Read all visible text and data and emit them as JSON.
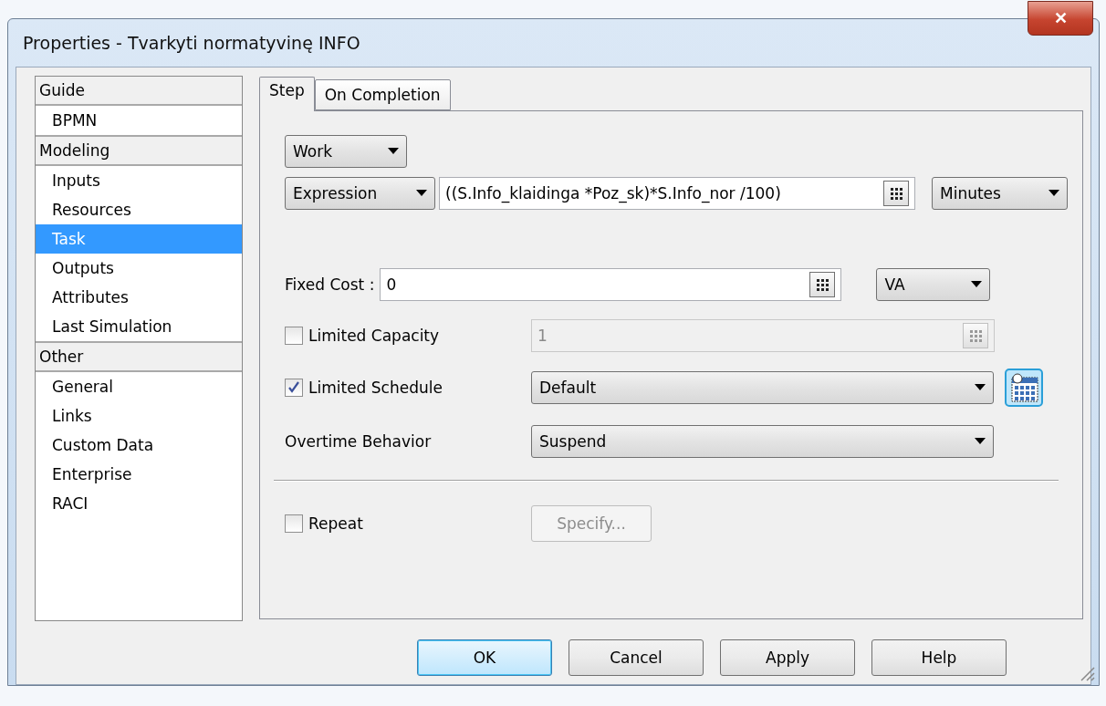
{
  "window": {
    "title": "Properties - Tvarkyti normatyvinę INFO",
    "close": "✕"
  },
  "sidebar": {
    "groups": [
      {
        "label": "Guide",
        "items": [
          {
            "label": "BPMN",
            "selected": false
          }
        ]
      },
      {
        "label": "Modeling",
        "items": [
          {
            "label": "Inputs",
            "selected": false
          },
          {
            "label": "Resources",
            "selected": false
          },
          {
            "label": "Task",
            "selected": true
          },
          {
            "label": "Outputs",
            "selected": false
          },
          {
            "label": "Attributes",
            "selected": false
          },
          {
            "label": "Last Simulation",
            "selected": false
          }
        ]
      },
      {
        "label": "Other",
        "items": [
          {
            "label": "General",
            "selected": false
          },
          {
            "label": "Links",
            "selected": false
          },
          {
            "label": "Custom Data",
            "selected": false
          },
          {
            "label": "Enterprise",
            "selected": false
          },
          {
            "label": "RACI",
            "selected": false
          }
        ]
      }
    ]
  },
  "tabs": [
    {
      "label": "Step",
      "selected": true
    },
    {
      "label": "On Completion",
      "selected": false
    }
  ],
  "step": {
    "type_select": "Work",
    "duration_mode": "Expression",
    "duration_expression": "((S.Info_klaidinga *Poz_sk)*S.Info_nor /100)",
    "duration_unit": "Minutes",
    "fixed_cost": {
      "label": "Fixed Cost :",
      "value": "0",
      "category": "VA"
    },
    "limited_capacity": {
      "label": "Limited Capacity",
      "checked": false,
      "value": "1",
      "disabled": true
    },
    "limited_schedule": {
      "label": "Limited Schedule",
      "checked": true,
      "value": "Default"
    },
    "overtime_behavior": {
      "label": "Overtime Behavior",
      "value": "Suspend"
    },
    "repeat": {
      "label": "Repeat",
      "checked": false,
      "button": "Specify...",
      "disabled": true
    }
  },
  "buttons": [
    {
      "label": "OK",
      "default": true
    },
    {
      "label": "Cancel",
      "default": false
    },
    {
      "label": "Apply",
      "default": false
    },
    {
      "label": "Help",
      "default": false
    }
  ]
}
